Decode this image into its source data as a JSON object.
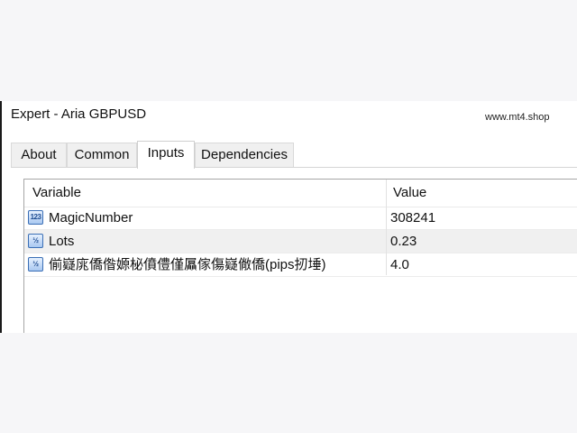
{
  "window": {
    "title": "Expert - Aria GBPUSD",
    "watermark": "www.mt4.shop"
  },
  "tabs": [
    {
      "label": "About",
      "selected": false
    },
    {
      "label": "Common",
      "selected": false
    },
    {
      "label": "Inputs",
      "selected": true
    },
    {
      "label": "Dependencies",
      "selected": false
    }
  ],
  "table": {
    "columns": [
      "Variable",
      "Value"
    ],
    "rows": [
      {
        "icon": "integer-param-icon",
        "icon_text": "123",
        "variable": "MagicNumber",
        "value": "308241"
      },
      {
        "icon": "double-param-icon",
        "icon_text": "½",
        "variable": "Lots",
        "value": "0.23"
      },
      {
        "icon": "double-param-icon",
        "icon_text": "½",
        "variable": "偂嶷庣僑偺嫄柲僨僼僅屭傢傷嶷僘僑(pips扨埵)",
        "value": "4.0"
      }
    ]
  },
  "colors": {
    "window_bg": "#ffffff",
    "page_bg": "#f6f6f8",
    "alt_row": "#f0f0f0",
    "icon_border": "#3b6fb6"
  }
}
